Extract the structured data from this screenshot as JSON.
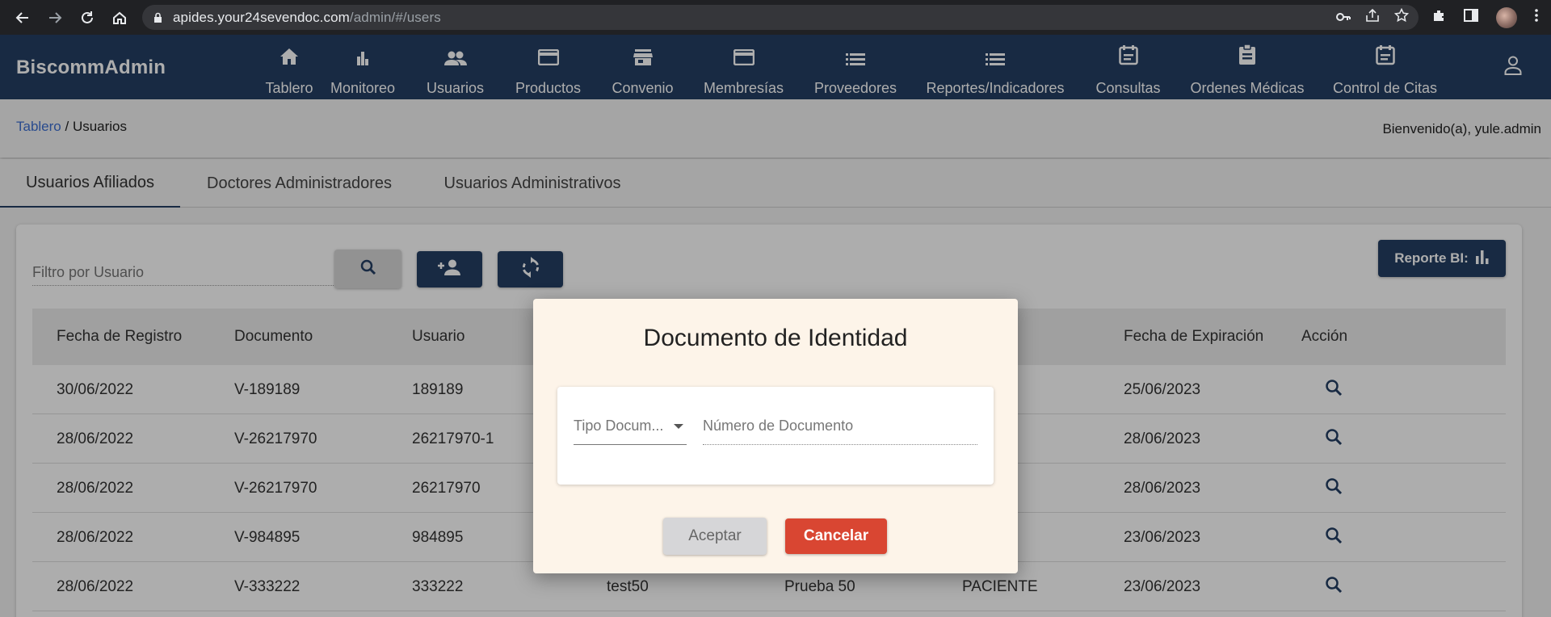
{
  "browser": {
    "url_host": "apides.your24sevendoc.com",
    "url_path": "/admin/#/users"
  },
  "app": {
    "brand": "BiscommAdmin",
    "nav": [
      {
        "label": "Tablero",
        "icon": "home-icon"
      },
      {
        "label": "Monitoreo",
        "icon": "bar-chart-icon"
      },
      {
        "label": "Usuarios",
        "icon": "people-icon"
      },
      {
        "label": "Productos",
        "icon": "card-icon"
      },
      {
        "label": "Convenio",
        "icon": "store-icon"
      },
      {
        "label": "Membresías",
        "icon": "card-icon"
      },
      {
        "label": "Proveedores",
        "icon": "list-icon"
      },
      {
        "label": "Reportes/Indicadores",
        "icon": "list-icon"
      },
      {
        "label": "Consultas",
        "icon": "calendar-note-icon"
      },
      {
        "label": "Ordenes Médicas",
        "icon": "clipboard-icon"
      },
      {
        "label": "Control de Citas",
        "icon": "calendar-note-icon"
      }
    ]
  },
  "breadcrumb": {
    "link": "Tablero",
    "separator": " / ",
    "current": "Usuarios"
  },
  "welcome": "Bienvenido(a), yule.admin",
  "tabs": [
    {
      "label": "Usuarios Afiliados",
      "active": true
    },
    {
      "label": "Doctores Administradores",
      "active": false
    },
    {
      "label": "Usuarios Administrativos",
      "active": false
    }
  ],
  "toolbar": {
    "filter_placeholder": "Filtro por Usuario",
    "report_label": "Reporte BI:"
  },
  "table": {
    "headers": [
      "Fecha de Registro",
      "Documento",
      "Usuario",
      "",
      "",
      "",
      "Fecha de Expiración",
      "Acción"
    ],
    "rows": [
      {
        "fecha": "30/06/2022",
        "documento": "V-189189",
        "usuario": "189189",
        "col4": "",
        "col5": "",
        "col6": "E",
        "expira": "25/06/2023"
      },
      {
        "fecha": "28/06/2022",
        "documento": "V-26217970",
        "usuario": "26217970-1",
        "col4": "",
        "col5": "",
        "col6": "E",
        "expira": "28/06/2023"
      },
      {
        "fecha": "28/06/2022",
        "documento": "V-26217970",
        "usuario": "26217970",
        "col4": "",
        "col5": "",
        "col6": "E",
        "expira": "28/06/2023"
      },
      {
        "fecha": "28/06/2022",
        "documento": "V-984895",
        "usuario": "984895",
        "col4": "",
        "col5": "",
        "col6": "E",
        "expira": "23/06/2023"
      },
      {
        "fecha": "28/06/2022",
        "documento": "V-333222",
        "usuario": "333222",
        "col4": "test50",
        "col5": "Prueba 50",
        "col6": "PACIENTE",
        "expira": "23/06/2023"
      }
    ]
  },
  "modal": {
    "title": "Documento de Identidad",
    "doc_type_placeholder": "Tipo Docum...",
    "doc_number_placeholder": "Número de Documento",
    "accept": "Aceptar",
    "cancel": "Cancelar"
  },
  "colors": {
    "header": "#243f63",
    "accent_link": "#3d6fd1",
    "cancel": "#d94632",
    "modal_bg": "#fdf4e9"
  }
}
